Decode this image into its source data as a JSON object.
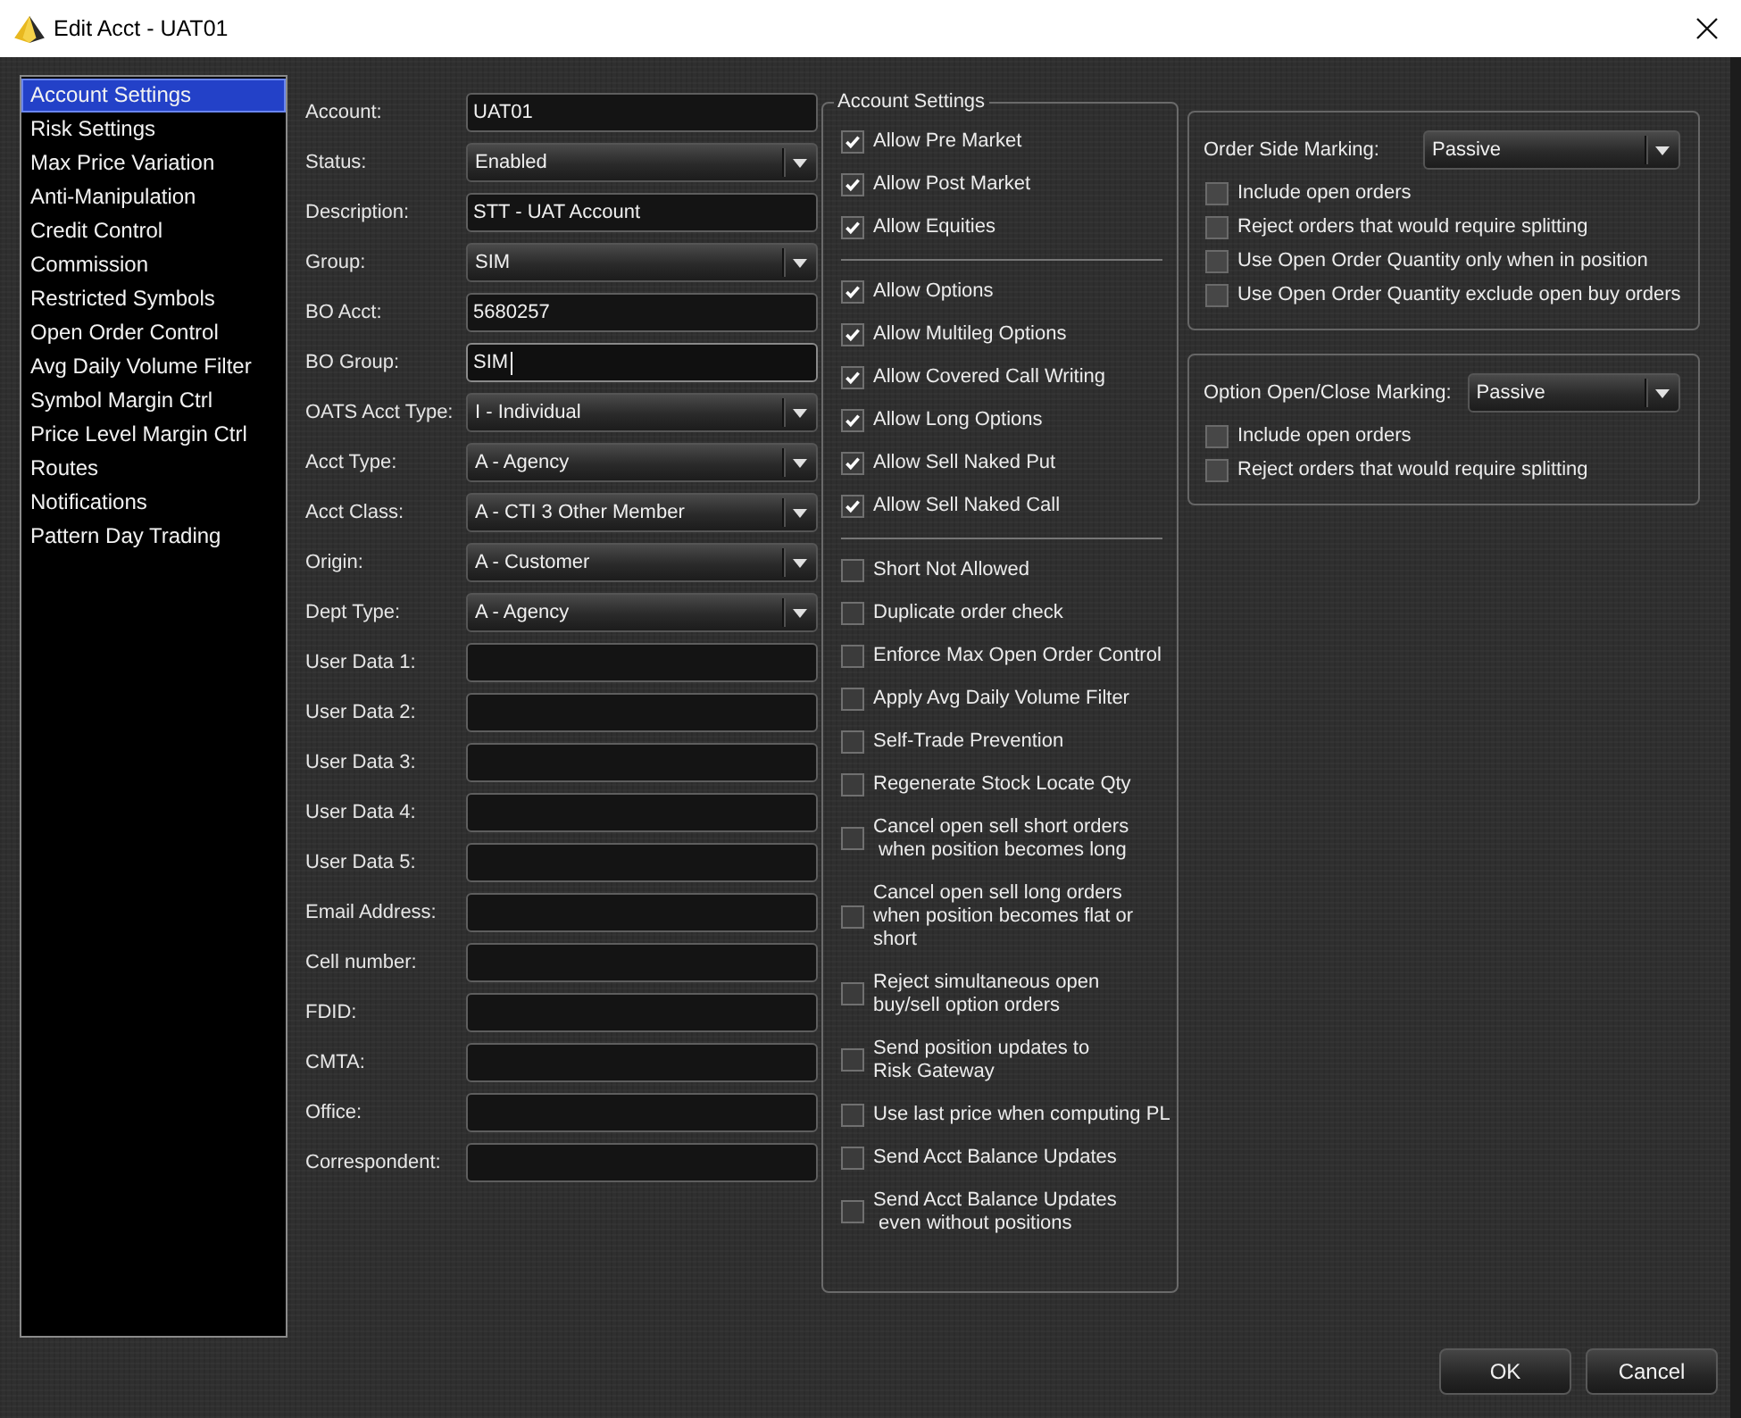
{
  "window": {
    "title": "Edit Acct - UAT01"
  },
  "sidebar": {
    "items": [
      {
        "label": "Account Settings",
        "selected": true
      },
      {
        "label": "Risk Settings",
        "selected": false
      },
      {
        "label": "Max Price Variation",
        "selected": false
      },
      {
        "label": "Anti-Manipulation",
        "selected": false
      },
      {
        "label": "Credit Control",
        "selected": false
      },
      {
        "label": "Commission",
        "selected": false
      },
      {
        "label": "Restricted Symbols",
        "selected": false
      },
      {
        "label": "Open Order Control",
        "selected": false
      },
      {
        "label": "Avg Daily Volume Filter",
        "selected": false
      },
      {
        "label": "Symbol Margin Ctrl",
        "selected": false
      },
      {
        "label": "Price Level Margin Ctrl",
        "selected": false
      },
      {
        "label": "Routes",
        "selected": false
      },
      {
        "label": "Notifications",
        "selected": false
      },
      {
        "label": "Pattern Day Trading",
        "selected": false
      }
    ]
  },
  "form": {
    "fields": [
      {
        "label": "Account:",
        "kind": "text",
        "value": "UAT01",
        "focused": false
      },
      {
        "label": "Status:",
        "kind": "dropdown",
        "value": "Enabled"
      },
      {
        "label": "Description:",
        "kind": "text",
        "value": "STT - UAT Account",
        "focused": false
      },
      {
        "label": "Group:",
        "kind": "dropdown",
        "value": "SIM"
      },
      {
        "label": "BO Acct:",
        "kind": "text",
        "value": "5680257",
        "focused": false
      },
      {
        "label": "BO Group:",
        "kind": "text",
        "value": "SIM",
        "focused": true
      },
      {
        "label": "OATS Acct Type:",
        "kind": "dropdown",
        "value": "I - Individual"
      },
      {
        "label": "Acct Type:",
        "kind": "dropdown",
        "value": "A - Agency"
      },
      {
        "label": "Acct Class:",
        "kind": "dropdown",
        "value": "A - CTI 3 Other Member"
      },
      {
        "label": "Origin:",
        "kind": "dropdown",
        "value": "A - Customer"
      },
      {
        "label": "Dept Type:",
        "kind": "dropdown",
        "value": "A - Agency"
      },
      {
        "label": "User Data 1:",
        "kind": "text",
        "focused": false
      },
      {
        "label": "User Data 2:",
        "kind": "text",
        "focused": false
      },
      {
        "label": "User Data 3:",
        "kind": "text",
        "focused": false
      },
      {
        "label": "User Data 4:",
        "kind": "text",
        "focused": false
      },
      {
        "label": "User Data 5:",
        "kind": "text",
        "focused": false
      },
      {
        "label": "Email Address:",
        "kind": "text",
        "focused": false
      },
      {
        "label": "Cell number:",
        "kind": "text",
        "focused": false
      },
      {
        "label": "FDID:",
        "kind": "text",
        "focused": false
      },
      {
        "label": "CMTA:",
        "kind": "text",
        "focused": false
      },
      {
        "label": "Office:",
        "kind": "text",
        "focused": false
      },
      {
        "label": "Correspondent:",
        "kind": "text",
        "focused": false
      }
    ]
  },
  "account_settings": {
    "title": "Account Settings",
    "sections": [
      {
        "options": [
          {
            "label": "Allow Pre Market",
            "checked": true
          },
          {
            "label": "Allow Post Market",
            "checked": true
          },
          {
            "label": "Allow Equities",
            "checked": true
          }
        ]
      },
      {
        "options": [
          {
            "label": "Allow Options",
            "checked": true
          },
          {
            "label": "Allow Multileg Options",
            "checked": true
          },
          {
            "label": "Allow Covered Call Writing",
            "checked": true
          },
          {
            "label": "Allow Long Options",
            "checked": true
          },
          {
            "label": "Allow Sell Naked Put",
            "checked": true
          },
          {
            "label": "Allow Sell Naked Call",
            "checked": true
          }
        ]
      },
      {
        "options": [
          {
            "label": "Short Not Allowed",
            "checked": false
          },
          {
            "label": "Duplicate order check",
            "checked": false
          },
          {
            "label": "Enforce Max Open Order Control",
            "checked": false
          },
          {
            "label": "Apply Avg Daily Volume Filter",
            "checked": false
          },
          {
            "label": "Self-Trade Prevention",
            "checked": false
          },
          {
            "label": "Regenerate Stock Locate Qty",
            "checked": false
          },
          {
            "label": "Cancel open sell short orders\n when position becomes long",
            "checked": false
          },
          {
            "label": "Cancel open sell long orders\nwhen position becomes flat or\nshort",
            "checked": false
          },
          {
            "label": "Reject simultaneous open\nbuy/sell option orders",
            "checked": false
          },
          {
            "label": "Send position updates to\nRisk Gateway",
            "checked": false
          },
          {
            "label": "Use last price when computing PL",
            "checked": false
          },
          {
            "label": "Send Acct Balance Updates",
            "checked": false
          },
          {
            "label": "Send Acct Balance Updates\n even without positions",
            "checked": false
          }
        ]
      }
    ]
  },
  "marking_panels": [
    {
      "label": "Order Side Marking:",
      "value": "Passive",
      "options": [
        {
          "label": "Include open orders",
          "checked": false
        },
        {
          "label": "Reject orders that would require splitting",
          "checked": false
        },
        {
          "label": "Use Open Order Quantity only when in position",
          "checked": false
        },
        {
          "label": "Use Open Order Quantity exclude open buy orders",
          "checked": false
        }
      ]
    },
    {
      "label": "Option Open/Close Marking:",
      "value": "Passive",
      "options": [
        {
          "label": "Include open orders",
          "checked": false
        },
        {
          "label": "Reject orders that would require splitting",
          "checked": false
        }
      ]
    }
  ],
  "buttons": [
    "OK",
    "Cancel"
  ]
}
